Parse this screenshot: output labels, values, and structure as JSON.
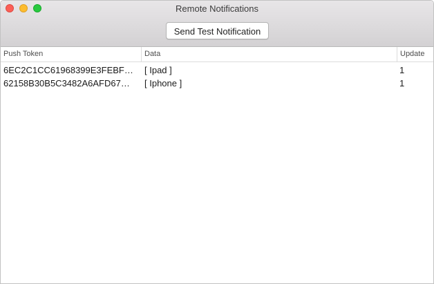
{
  "window": {
    "title": "Remote Notifications"
  },
  "toolbar": {
    "send_test_label": "Send Test Notification"
  },
  "table": {
    "columns": [
      "Push Token",
      "Data",
      "Update"
    ],
    "rows": [
      {
        "token": "6EC2C1CC61968399E3FEBF…",
        "data": "[ Ipad ]",
        "update": "1"
      },
      {
        "token": "62158B30B5C3482A6AFD67…",
        "data": "[ Iphone ]",
        "update": "1"
      }
    ]
  },
  "colors": {
    "close": "#fc5f57",
    "minimize": "#fdbc2e",
    "zoom": "#29c940"
  }
}
